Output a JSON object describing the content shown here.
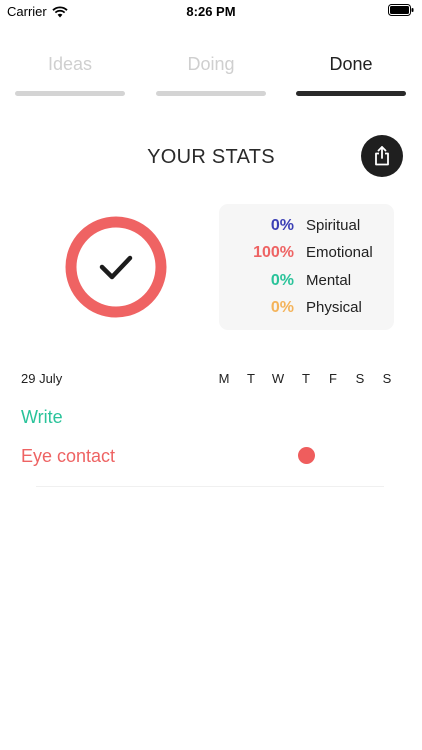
{
  "status_bar": {
    "carrier": "Carrier",
    "time": "8:26 PM"
  },
  "tabs": [
    {
      "label": "Ideas",
      "active": false
    },
    {
      "label": "Doing",
      "active": false
    },
    {
      "label": "Done",
      "active": true
    }
  ],
  "stats": {
    "title": "YOUR STATS",
    "categories": [
      {
        "percent": "0%",
        "name": "Spiritual",
        "color": "#3b3fb5"
      },
      {
        "percent": "100%",
        "name": "Emotional",
        "color": "#ee6363"
      },
      {
        "percent": "0%",
        "name": "Mental",
        "color": "#2ac39a"
      },
      {
        "percent": "0%",
        "name": "Physical",
        "color": "#f4b35a"
      }
    ]
  },
  "week": {
    "date": "29 July",
    "days": [
      "M",
      "T",
      "W",
      "T",
      "F",
      "S",
      "S"
    ]
  },
  "habits": [
    {
      "name": "Write",
      "color": "#2ac39a",
      "done_days": []
    },
    {
      "name": "Eye contact",
      "color": "#ee6363",
      "done_days": [
        "T"
      ]
    }
  ],
  "colors": {
    "ring": "#ef6363",
    "accent_dark": "#1f1f1f"
  }
}
